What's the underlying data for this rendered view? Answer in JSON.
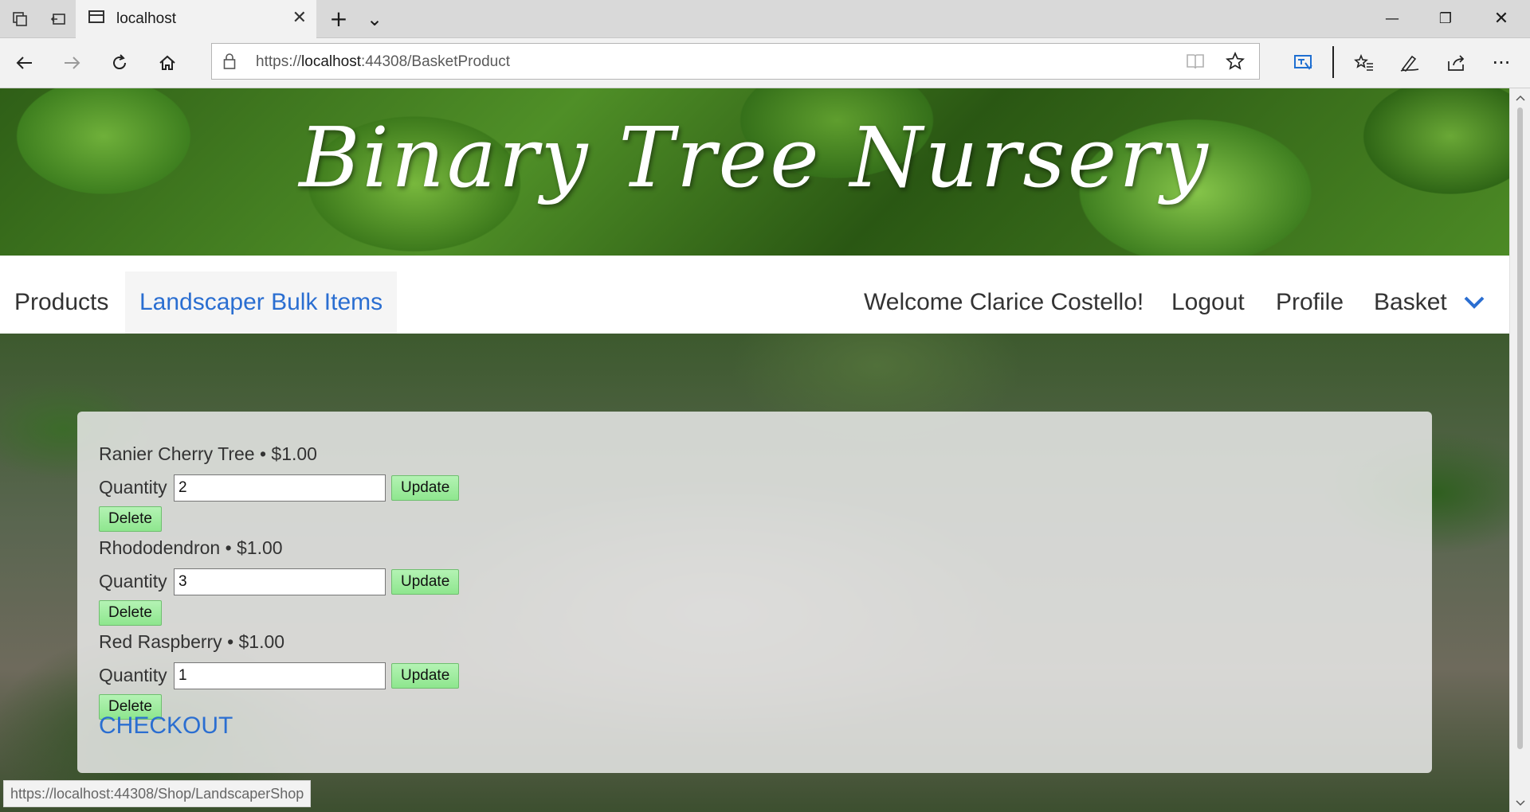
{
  "browser": {
    "tab_title": "localhost",
    "tab_close": "✕",
    "new_tab": "+",
    "tab_list": "⌄",
    "url_prefix": "https://",
    "url_host": "localhost",
    "url_rest": ":44308/BasketProduct",
    "status_url": "https://localhost:44308/Shop/LandscaperShop",
    "window_minimize": "—",
    "window_restore": "❐",
    "window_close": "✕"
  },
  "site": {
    "title": "Binary Tree Nursery"
  },
  "nav": {
    "products": "Products",
    "landscaper": "Landscaper Bulk Items",
    "welcome": "Welcome Clarice Costello!",
    "logout": "Logout",
    "profile": "Profile",
    "basket": "Basket"
  },
  "basket": {
    "quantity_label": "Quantity",
    "update_label": "Update",
    "delete_label": "Delete",
    "items": [
      {
        "title": "Ranier Cherry Tree • $1.00",
        "quantity": "2"
      },
      {
        "title": "Rhododendron • $1.00",
        "quantity": "3"
      },
      {
        "title": "Red Raspberry • $1.00",
        "quantity": "1"
      }
    ],
    "checkout": "CHECKOUT"
  },
  "colors": {
    "accent_link": "#2a6ed1",
    "button_green": "#8ee68e"
  }
}
